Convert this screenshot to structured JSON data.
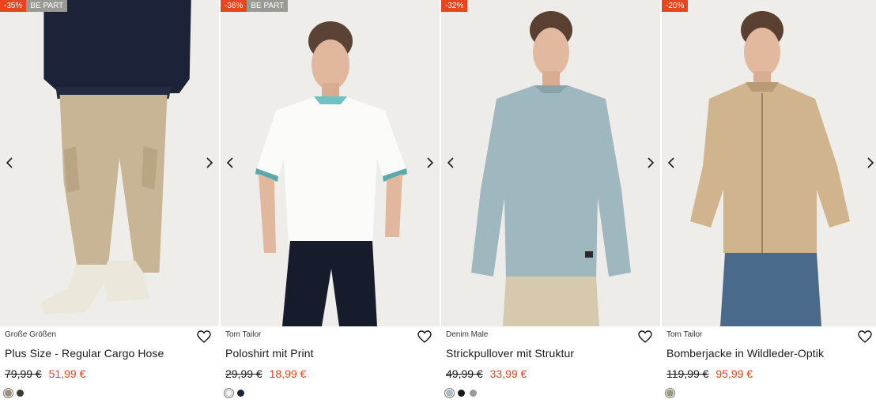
{
  "products": [
    {
      "badges": [
        {
          "text": "-35%",
          "type": "sale"
        },
        {
          "text": "BE PART",
          "type": "part"
        }
      ],
      "brand": "Große Größen",
      "name": "Plus Size - Regular Cargo Hose",
      "old_price": "79,99 €",
      "new_price": "51,99 €",
      "swatches": [
        "#9c8f7c",
        "#3d3a32"
      ]
    },
    {
      "badges": [
        {
          "text": "-36%",
          "type": "sale"
        },
        {
          "text": "BE PART",
          "type": "part"
        }
      ],
      "brand": "Tom Tailor",
      "name": "Poloshirt mit Print",
      "old_price": "29,99 €",
      "new_price": "18,99 €",
      "swatches": [
        "#f2f2ef",
        "#1e2438"
      ]
    },
    {
      "badges": [
        {
          "text": "-32%",
          "type": "sale"
        }
      ],
      "brand": "Denim Male",
      "name": "Strickpullover mit Struktur",
      "old_price": "49,99 €",
      "new_price": "33,99 €",
      "swatches": [
        "#a9bcc2",
        "#1a1a1a",
        "#9a9a9a"
      ]
    },
    {
      "badges": [
        {
          "text": "-20%",
          "type": "sale"
        }
      ],
      "brand": "Tom Tailor",
      "name": "Bomberjacke in Wildleder-Optik",
      "old_price": "119,99 €",
      "new_price": "95,99 €",
      "swatches": [
        "#9c9a76"
      ]
    }
  ],
  "colors": {
    "sale": "#e8451e",
    "part": "#9a9a94"
  },
  "icons": {
    "prev": "chevron-left-icon",
    "next": "chevron-right-icon",
    "wishlist": "heart-icon"
  }
}
